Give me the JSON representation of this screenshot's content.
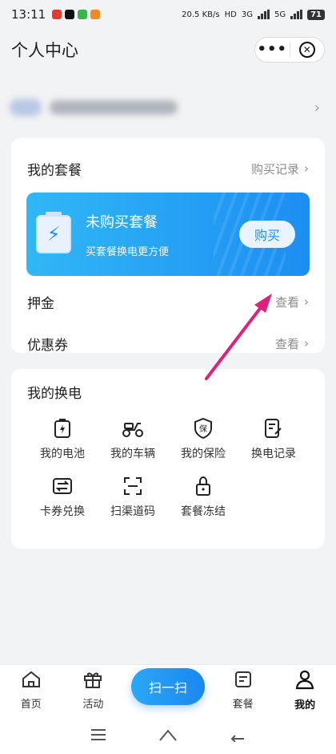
{
  "status": {
    "time": "13:11",
    "net_speed": "20.5 KB/s",
    "net_hd": "HD",
    "net_3g": "3G",
    "net_5g": "5G",
    "battery": "71"
  },
  "header": {
    "title": "个人中心"
  },
  "plan": {
    "title": "我的套餐",
    "history_link": "购买记录",
    "banner": {
      "title": "未购买套餐",
      "subtitle": "买套餐换电更方便",
      "button": "购买"
    },
    "deposit_label": "押金",
    "deposit_link": "查看",
    "coupon_label": "优惠券",
    "coupon_link": "查看"
  },
  "swap": {
    "title": "我的换电",
    "items": [
      {
        "label": "我的电池",
        "icon": "battery-icon"
      },
      {
        "label": "我的车辆",
        "icon": "scooter-icon"
      },
      {
        "label": "我的保险",
        "icon": "insurance-shield-icon"
      },
      {
        "label": "换电记录",
        "icon": "record-icon"
      },
      {
        "label": "卡券兑换",
        "icon": "exchange-icon"
      },
      {
        "label": "扫渠道码",
        "icon": "scan-frame-icon"
      },
      {
        "label": "套餐冻结",
        "icon": "lock-icon"
      }
    ]
  },
  "tabbar": {
    "home": "首页",
    "activity": "活动",
    "scan": "扫一扫",
    "package": "套餐",
    "mine": "我的"
  },
  "colors": {
    "accent": "#1c8ef2",
    "arrow": "#e0207a"
  }
}
